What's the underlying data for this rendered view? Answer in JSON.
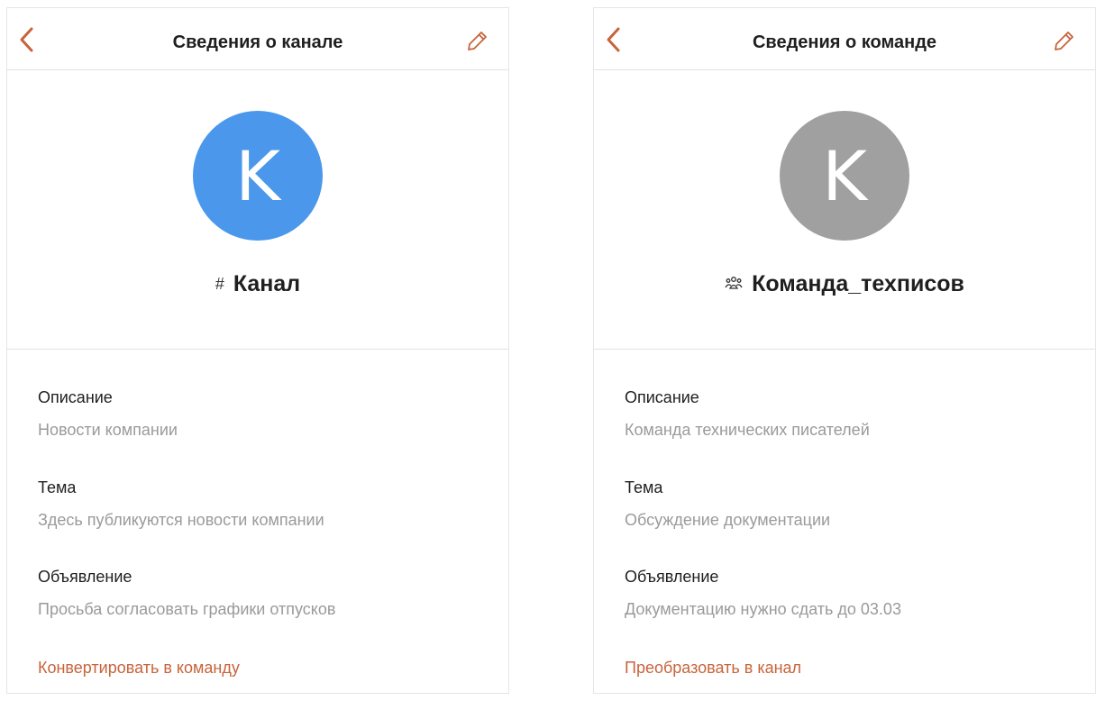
{
  "panels": [
    {
      "header_title": "Сведения о канале",
      "avatar_letter": "K",
      "avatar_color": "#4a97ec",
      "name_prefix": "#",
      "name": "Канал",
      "description_label": "Описание",
      "description_value": "Новости компании",
      "topic_label": "Тема",
      "topic_value": "Здесь публикуются новости компании",
      "announcement_label": "Объявление",
      "announcement_value": "Просьба согласовать графики отпусков",
      "action_label": "Конвертировать в команду"
    },
    {
      "header_title": "Сведения о команде",
      "avatar_letter": "K",
      "avatar_color": "#a0a0a0",
      "name_prefix_icon": "team-icon",
      "name": "Команда_техписов",
      "description_label": "Описание",
      "description_value": "Команда технических писателей",
      "topic_label": "Тема",
      "topic_value": "Обсуждение документации",
      "announcement_label": "Объявление",
      "announcement_value": "Документацию нужно сдать до 03.03",
      "action_label": "Преобразовать в канал"
    }
  ],
  "colors": {
    "accent": "#c7643b",
    "label": "#1f1f1f",
    "value": "#9a9a9a",
    "divider": "#e3e3e3"
  },
  "icons": {
    "back": "chevron-left-icon",
    "edit": "pencil-icon"
  }
}
